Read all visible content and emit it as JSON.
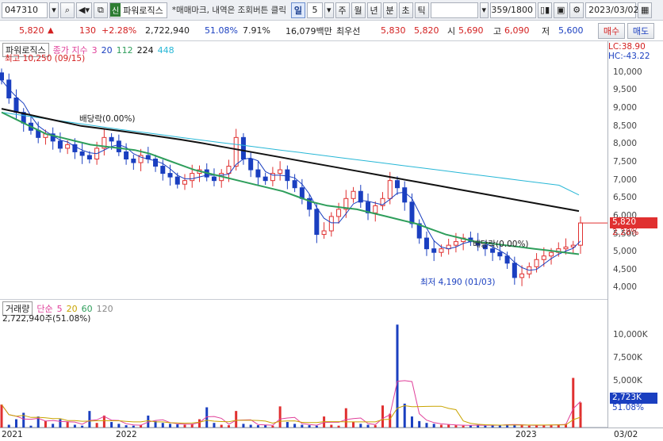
{
  "toolbar": {
    "code": "047310",
    "search_icon": "search-icon",
    "market_badge": "신",
    "stock_name": "파워로직스",
    "hint": "*매매마크, 내역은 조회버튼 클릭",
    "period_day": "일",
    "period_value": "5",
    "period_week": "주",
    "period_month": "월",
    "period_year": "년",
    "period_minute": "분",
    "period_second": "초",
    "period_tick": "틱",
    "count": "359/1800",
    "date": "2023/03/02"
  },
  "quote": {
    "price": "5,820",
    "change_arrow": "▲",
    "change": "130",
    "change_pct": "+2.28%",
    "volume": "2,722,940",
    "vol_ratio": "51.08%",
    "turnover": "7.91%",
    "amount": "16,079백만",
    "best_bid_label": "최우선",
    "ask": "5,830",
    "bid": "5,820",
    "open_label": "시",
    "open": "5,690",
    "high_label": "고",
    "high": "6,090",
    "low_label": "저",
    "low": "5,600",
    "buy_label": "매수",
    "sell_label": "매도"
  },
  "price_panel": {
    "title": "파워로직스",
    "ma_label": "종가 지수",
    "ma_periods": [
      "3",
      "20",
      "112",
      "224",
      "448"
    ],
    "ma_colors": [
      "#e0409a",
      "#1a3fc0",
      "#2e9e5b",
      "#111111",
      "#27b7d6"
    ],
    "max_label": "최고 10,250 (09/15)",
    "min_label": "최저 4,190 (01/03)",
    "annotation_top": "배당락(0.00%)",
    "annotation_bottom": "배당락(0.00%)",
    "lc_label": "LC:38.90",
    "hc_label": "HC:-43.22",
    "current_price_tag": "5,820",
    "current_pct_tag": "2.28%",
    "y_ticks": [
      "10,000",
      "9,500",
      "9,000",
      "8,500",
      "8,000",
      "7,500",
      "7,000",
      "6,500",
      "6,000",
      "5,500",
      "5,000",
      "4,500",
      "4,000"
    ]
  },
  "volume_panel": {
    "title": "거래량",
    "ma_label": "단순",
    "ma_periods": [
      "5",
      "20",
      "60",
      "120"
    ],
    "ma_colors": [
      "#e0409a",
      "#c9a400",
      "#2e9e5b",
      "#888888"
    ],
    "value_label": "2,722,940주(51.08%)",
    "current_tag": "2,723K",
    "current_pct_tag": "51.08%",
    "y_ticks": [
      "10,000K",
      "7,500K",
      "5,000K"
    ]
  },
  "x_axis": {
    "labels": [
      "2021",
      "2022",
      "2023"
    ],
    "end_label": "03/02"
  },
  "chart_data": {
    "type": "candlestick",
    "price_ylim": [
      4000,
      10250
    ],
    "max": {
      "value": 10250,
      "date": "09/15"
    },
    "min": {
      "value": 4190,
      "date": "01/03"
    },
    "last": {
      "open": 5690,
      "high": 6090,
      "low": 5600,
      "close": 5820
    },
    "close_series": [
      9800,
      9300,
      8900,
      8600,
      8400,
      8200,
      8300,
      8100,
      7900,
      8000,
      7800,
      7700,
      7600,
      7900,
      8200,
      8100,
      7800,
      7600,
      7500,
      7700,
      7600,
      7400,
      7200,
      7100,
      6900,
      7000,
      7200,
      7300,
      7100,
      7000,
      7200,
      7400,
      8200,
      7600,
      7300,
      7100,
      7000,
      7200,
      7300,
      7000,
      6800,
      6500,
      6200,
      5500,
      5600,
      6000,
      6200,
      6500,
      6700,
      6400,
      6100,
      6300,
      6500,
      7000,
      6800,
      6400,
      5800,
      5400,
      5100,
      5000,
      5100,
      5200,
      5300,
      5400,
      5300,
      5200,
      5100,
      5000,
      4900,
      4700,
      4300,
      4400,
      4600,
      4800,
      4900,
      5000,
      5100,
      5150,
      5200,
      5820
    ],
    "ma112": [
      8900,
      8700,
      8500,
      8300,
      8200,
      8100,
      8000,
      7950,
      7900,
      7850,
      7750,
      7600,
      7450,
      7300,
      7200,
      7100,
      7000,
      6900,
      6800,
      6700,
      6550,
      6400,
      6300,
      6250,
      6200,
      6100,
      6000,
      5900,
      5800,
      5650,
      5500,
      5400,
      5300,
      5250,
      5200,
      5150,
      5100,
      5050,
      5000,
      4950
    ],
    "ma224": [
      9000,
      8880,
      8760,
      8640,
      8520,
      8450,
      8380,
      8300,
      8220,
      8140,
      8050,
      7950,
      7850,
      7750,
      7650,
      7550,
      7450,
      7350,
      7250,
      7150,
      7050,
      6950,
      6850,
      6750,
      6650,
      6550,
      6450,
      6350,
      6250,
      6150
    ],
    "ma448": [
      8900,
      8820,
      8740,
      8660,
      8580,
      8500,
      8420,
      8350,
      8280,
      8200,
      8130,
      8060,
      7990,
      7920,
      7850,
      7780,
      7710,
      7640,
      7570,
      7500,
      7430,
      7360,
      7290,
      7220,
      7150,
      7080,
      7010,
      6940,
      6870,
      6600
    ],
    "volume_ylim": [
      0,
      12000
    ],
    "volume_k": [
      2500,
      300,
      900,
      1600,
      200,
      1200,
      700,
      400,
      900,
      600,
      300,
      200,
      1800,
      500,
      1300,
      600,
      400,
      250,
      200,
      300,
      1300,
      700,
      500,
      400,
      350,
      300,
      400,
      900,
      2200,
      500,
      300,
      250,
      1800,
      400,
      300,
      250,
      300,
      200,
      2300,
      600,
      400,
      300,
      250,
      200,
      1200,
      300,
      200,
      2100,
      600,
      400,
      300,
      250,
      2400,
      1500,
      11200,
      2600,
      1200,
      700,
      500,
      400,
      300,
      300,
      250,
      200,
      250,
      300,
      200,
      250,
      300,
      350,
      300,
      250,
      200,
      250,
      300,
      250,
      350,
      400,
      5400,
      2723
    ]
  }
}
